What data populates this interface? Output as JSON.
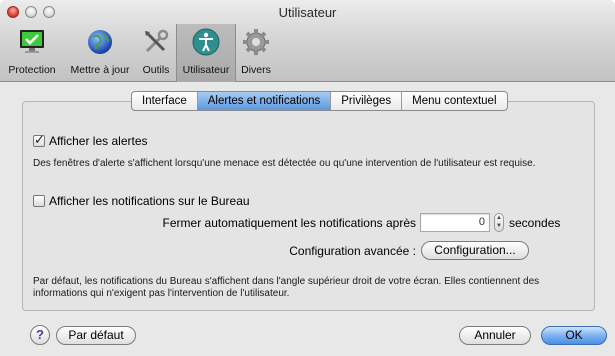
{
  "window": {
    "title": "Utilisateur"
  },
  "toolbar": {
    "items": [
      {
        "label": "Protection",
        "icon": "monitor-check-icon"
      },
      {
        "label": "Mettre à jour",
        "icon": "globe-icon"
      },
      {
        "label": "Outils",
        "icon": "tools-icon"
      },
      {
        "label": "Utilisateur",
        "icon": "user-accessibility-icon",
        "selected": true
      },
      {
        "label": "Divers",
        "icon": "gear-icon"
      }
    ]
  },
  "tabs": [
    {
      "label": "Interface"
    },
    {
      "label": "Alertes et notifications",
      "active": true
    },
    {
      "label": "Privilèges"
    },
    {
      "label": "Menu contextuel"
    }
  ],
  "alerts": {
    "checkbox_label": "Afficher les alertes",
    "checked": true,
    "description": "Des fenêtres d'alerte s'affichent lorsqu'une menace est détectée ou qu'une intervention de l'utilisateur est requise."
  },
  "notifications": {
    "checkbox_label": "Afficher les notifications sur le Bureau",
    "checked": false,
    "auto_close_label": "Fermer automatiquement les notifications après",
    "auto_close_value": "0",
    "auto_close_unit": "secondes",
    "advanced_label": "Configuration avancée :",
    "advanced_button": "Configuration...",
    "description": "Par défaut, les notifications du Bureau s'affichent dans l'angle supérieur droit de votre écran. Elles contiennent des informations qui n'exigent pas l'intervention de l'utilisateur."
  },
  "footer": {
    "help_label": "?",
    "default_button": "Par défaut",
    "cancel_button": "Annuler",
    "ok_button": "OK"
  },
  "colors": {
    "accent": "#5d97df",
    "close_button": "#e5453a"
  }
}
